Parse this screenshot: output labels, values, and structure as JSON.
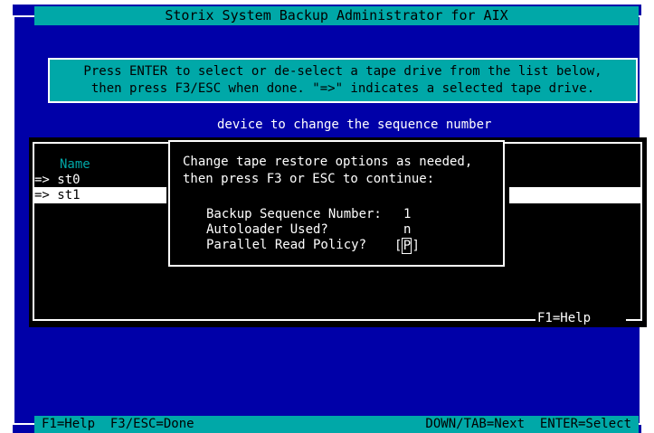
{
  "title": "Storix System Backup Administrator for AIX",
  "instructions": {
    "line1": "Press ENTER to select or de-select a tape drive from the list below,",
    "line2": "then press F3/ESC when done. \"=>\" indicates a selected tape drive."
  },
  "device_hint": "device to change the sequence number",
  "list": {
    "header": "Name",
    "items": [
      {
        "label": "=> st0"
      },
      {
        "label": "=> st1"
      }
    ],
    "f1_label": "F1=Help"
  },
  "popup": {
    "line1": "Change tape restore options as needed,",
    "line2": "then press F3 or ESC to continue:",
    "fields": [
      {
        "label": "Backup Sequence Number:",
        "value": "1"
      },
      {
        "label": "Autoloader Used?",
        "value": "n"
      },
      {
        "label": "Parallel Read Policy?",
        "value": "P"
      }
    ]
  },
  "statusbar": {
    "left": "F1=Help  F3/ESC=Done",
    "right": "DOWN/TAB=Next  ENTER=Select"
  },
  "colors": {
    "background": "#0000a8",
    "bar": "#00a8a8",
    "panel": "#000000",
    "text": "#ffffff"
  }
}
